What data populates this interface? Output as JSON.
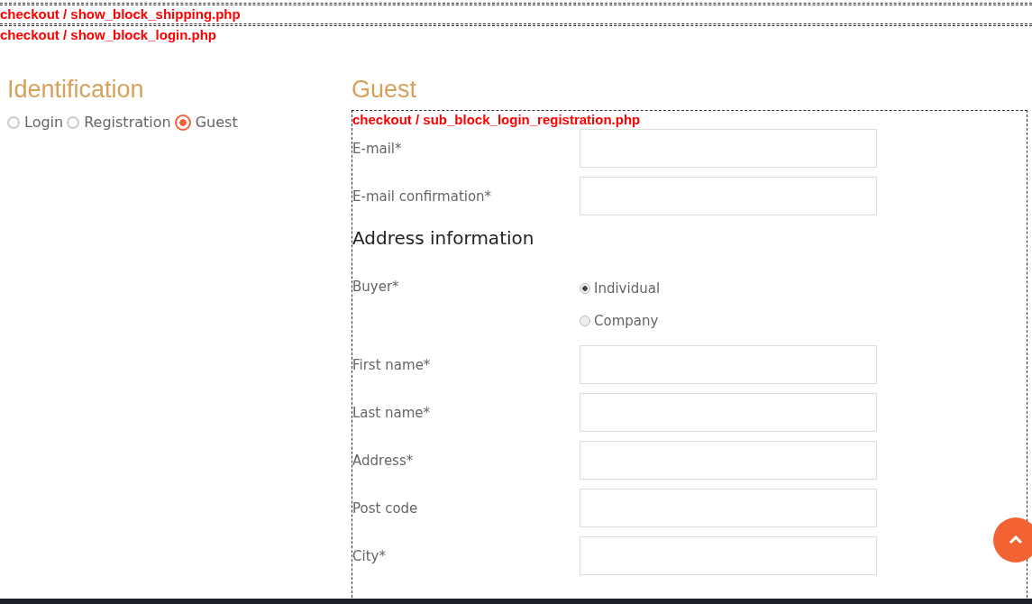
{
  "debug_paths": [
    "checkout / show_block_shipping.php",
    "checkout / show_block_login.php"
  ],
  "identification": {
    "title": "Identification",
    "options": [
      {
        "label": "Login",
        "selected": false
      },
      {
        "label": "Registration",
        "selected": false
      },
      {
        "label": "Guest",
        "selected": true
      }
    ]
  },
  "guest": {
    "title": "Guest",
    "debug_path": "checkout / sub_block_login_registration.php",
    "email_fields": [
      {
        "label": "E-mail*"
      },
      {
        "label": "E-mail confirmation*"
      }
    ],
    "address_heading": "Address information",
    "buyer": {
      "label": "Buyer*",
      "options": [
        {
          "label": "Individual",
          "selected": true
        },
        {
          "label": "Company",
          "selected": false
        }
      ]
    },
    "address_fields": [
      {
        "label": "First name*"
      },
      {
        "label": "Last name*"
      },
      {
        "label": "Address*"
      },
      {
        "label": "Post code"
      },
      {
        "label": "City*"
      }
    ]
  }
}
